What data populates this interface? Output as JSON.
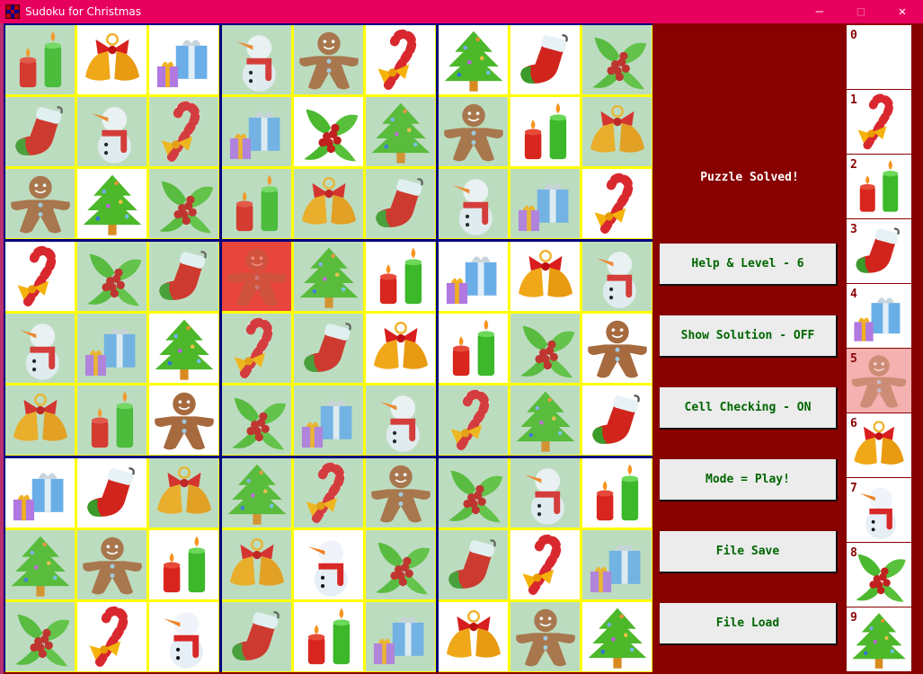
{
  "window": {
    "title": "Sudoku for Christmas",
    "controls": [
      "minimize",
      "maximize",
      "close"
    ]
  },
  "icons": {
    "1": "candy-cane",
    "2": "candles",
    "3": "stocking",
    "4": "gifts",
    "5": "gingerbread-man",
    "6": "bells",
    "7": "snowman",
    "8": "holly",
    "9": "christmas-tree"
  },
  "colors": {
    "given_cell": "#bcdcc0",
    "entered_cell": "#ffffff",
    "error_cell": "#e8453c",
    "block_border": "#000080",
    "cell_border": "#ffff00",
    "panel_bg": "#880000",
    "titlebar": "#e8005f",
    "button_text": "#006600"
  },
  "board": {
    "values": [
      [
        2,
        6,
        4,
        7,
        5,
        1,
        9,
        3,
        8
      ],
      [
        3,
        7,
        1,
        4,
        8,
        9,
        5,
        2,
        6
      ],
      [
        5,
        9,
        8,
        2,
        6,
        3,
        7,
        4,
        1
      ],
      [
        1,
        8,
        3,
        5,
        9,
        2,
        4,
        6,
        7
      ],
      [
        7,
        4,
        9,
        1,
        3,
        6,
        2,
        8,
        5
      ],
      [
        6,
        2,
        5,
        8,
        4,
        7,
        1,
        9,
        3
      ],
      [
        4,
        3,
        6,
        9,
        1,
        5,
        8,
        7,
        2
      ],
      [
        9,
        5,
        2,
        6,
        7,
        8,
        3,
        1,
        4
      ],
      [
        8,
        1,
        7,
        3,
        2,
        4,
        6,
        5,
        9
      ]
    ],
    "cell_states": [
      [
        "given",
        "entered",
        "entered",
        "given",
        "given",
        "entered",
        "entered",
        "entered",
        "given"
      ],
      [
        "given",
        "given",
        "given",
        "given",
        "entered",
        "given",
        "given",
        "entered",
        "given"
      ],
      [
        "given",
        "entered",
        "given",
        "given",
        "given",
        "given",
        "given",
        "given",
        "entered"
      ],
      [
        "entered",
        "given",
        "given",
        "error",
        "given",
        "entered",
        "entered",
        "entered",
        "given"
      ],
      [
        "given",
        "given",
        "entered",
        "given",
        "given",
        "entered",
        "entered",
        "given",
        "entered"
      ],
      [
        "given",
        "given",
        "entered",
        "given",
        "given",
        "given",
        "given",
        "given",
        "entered"
      ],
      [
        "entered",
        "entered",
        "given",
        "given",
        "given",
        "given",
        "given",
        "given",
        "entered"
      ],
      [
        "given",
        "given",
        "entered",
        "given",
        "entered",
        "given",
        "given",
        "entered",
        "given"
      ],
      [
        "given",
        "entered",
        "entered",
        "given",
        "entered",
        "given",
        "entered",
        "given",
        "entered"
      ]
    ]
  },
  "panel": {
    "status": "Puzzle Solved!",
    "buttons": [
      {
        "id": "help-level",
        "label": "Help & Level - 6"
      },
      {
        "id": "show-solution",
        "label": "Show Solution - OFF"
      },
      {
        "id": "cell-checking",
        "label": "Cell Checking - ON"
      },
      {
        "id": "mode",
        "label": "Mode = Play!"
      },
      {
        "id": "file-save",
        "label": "File Save"
      },
      {
        "id": "file-load",
        "label": "File Load"
      }
    ]
  },
  "palette": {
    "selected": 5,
    "items": [
      {
        "num": "0",
        "icon": ""
      },
      {
        "num": "1",
        "icon": "candy-cane"
      },
      {
        "num": "2",
        "icon": "candles"
      },
      {
        "num": "3",
        "icon": "stocking"
      },
      {
        "num": "4",
        "icon": "gifts"
      },
      {
        "num": "5",
        "icon": "gingerbread-man"
      },
      {
        "num": "6",
        "icon": "bells"
      },
      {
        "num": "7",
        "icon": "snowman"
      },
      {
        "num": "8",
        "icon": "holly"
      },
      {
        "num": "9",
        "icon": "christmas-tree"
      }
    ]
  }
}
